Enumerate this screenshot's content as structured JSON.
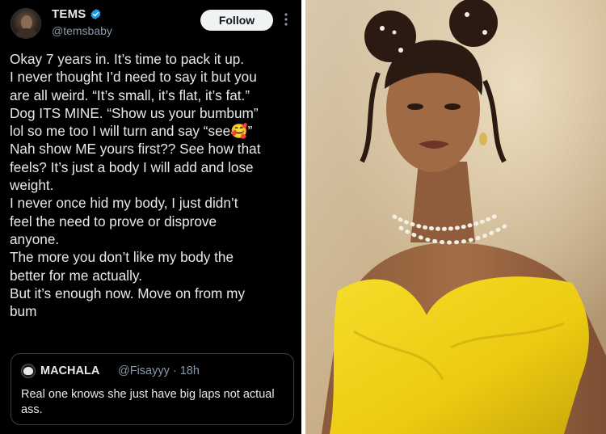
{
  "tweet": {
    "display_name": "TEMS",
    "handle": "@temsbaby",
    "follow_label": "Follow",
    "verified_icon": "verified-badge-icon",
    "lines": [
      "Okay 7 years in. It’s time to pack it up.",
      "I never thought I’d need to say it but you",
      "are all weird. “It’s small, it’s flat, it’s fat.”",
      "Dog ITS MINE. “Show us your bumbum”",
      "lol so me too I will turn and say “see🥰”",
      "Nah show ME yours first?? See how that",
      "feels? It’s just a body I will add and lose",
      "weight.",
      "I never once hid my body, I just didn’t",
      "feel the need to prove or disprove",
      "anyone.",
      "The more you don’t like my body the",
      "better for me actually.",
      "But it’s enough now. Move on from my",
      "bum"
    ]
  },
  "quote": {
    "display_name": "MACHALA",
    "handle_time": "@Fisayyy · 18h",
    "text": "Real one knows she just have big laps not actual ass."
  },
  "colors": {
    "background": "#000000",
    "text": "#e7e9ea",
    "muted": "#8b98a5",
    "verified": "#1d9bf0",
    "dress": "#f2d51a"
  }
}
